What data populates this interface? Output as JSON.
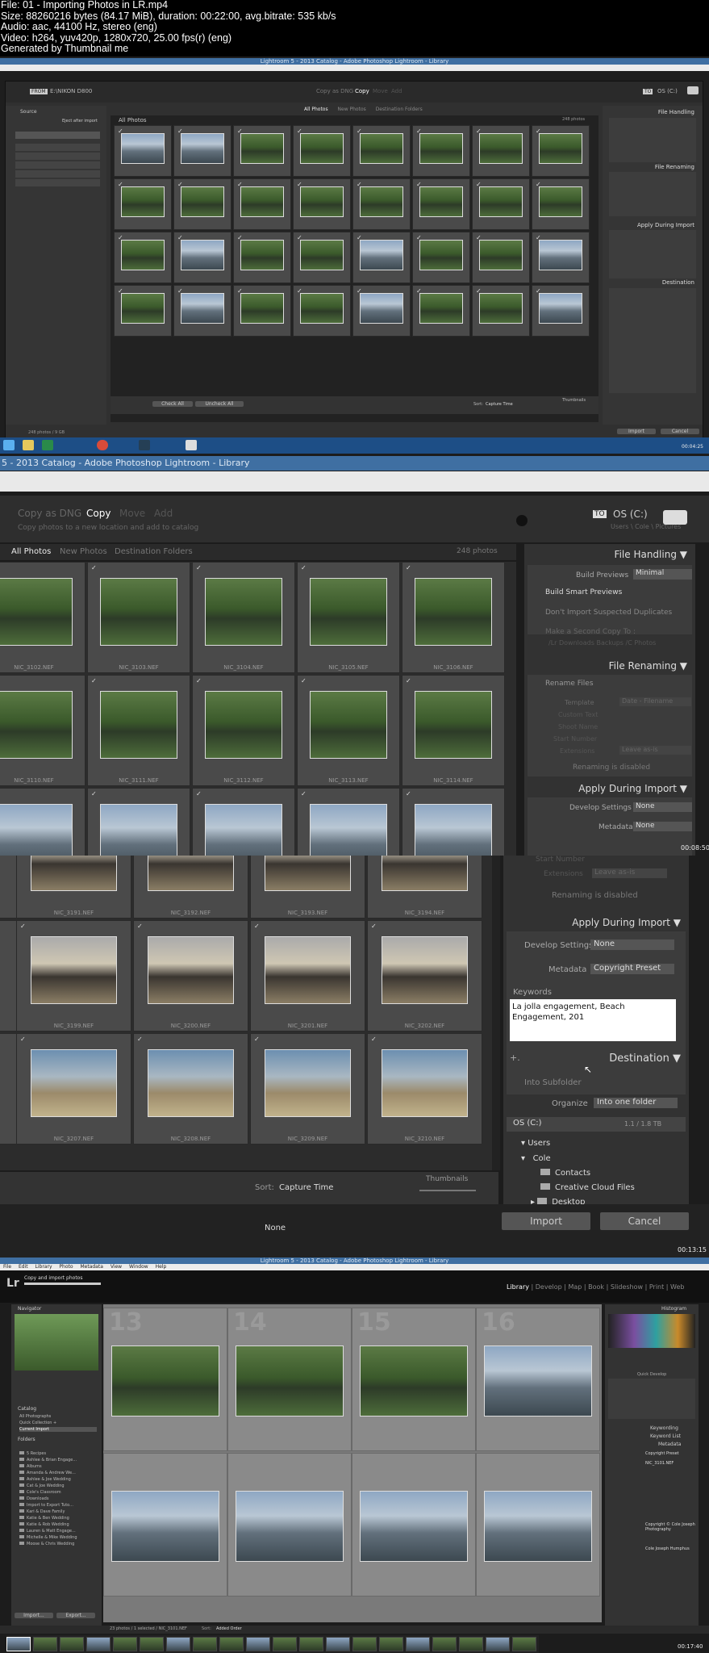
{
  "file_info": {
    "line1": "File: 01 - Importing Photos in LR.mp4",
    "line2": "Size: 88260216 bytes (84.17 MiB), duration: 00:22:00, avg.bitrate: 535 kb/s",
    "line3": "Audio: aac, 44100 Hz, stereo (eng)",
    "line4": "Video: h264, yuv420p, 1280x720, 25.00 fps(r) (eng)",
    "line5": "Generated by Thumbnail me"
  },
  "frame1": {
    "title": "Lightroom 5 - 2013 Catalog - Adobe Photoshop Lightroom - Library",
    "source_label": "FROM",
    "source_device": "E:\\NIKON D800",
    "modes": [
      "Copy as DNG",
      "Copy",
      "Move",
      "Add"
    ],
    "dest_label": "TO",
    "dest_drive": "OS (C:)",
    "tabs": [
      "All Photos",
      "New Photos",
      "Destination Folders"
    ],
    "grid_title": "All Photos",
    "count": "248 photos",
    "sources_title": "Source",
    "eject_label": "Eject after import",
    "buttons": {
      "check_all": "Check All",
      "uncheck_all": "Uncheck All",
      "import": "Import",
      "cancel": "Cancel"
    },
    "sort_label": "Sort:",
    "sort_value": "Capture Time",
    "thumbnails_label": "Thumbnails",
    "status": "248 photos / 9 GB",
    "right_sections": [
      "File Handling",
      "File Renaming",
      "Apply During Import",
      "Destination"
    ],
    "timestamp": "00:04:25"
  },
  "frame2": {
    "title": "5 - 2013 Catalog - Adobe Photoshop Lightroom - Library",
    "modes": [
      "Copy as DNG",
      "Copy",
      "Move",
      "Add"
    ],
    "subtitle": "Copy photos to a new location and add to catalog",
    "dest_label": "TO",
    "dest_drive": "OS (C:)",
    "dest_path": "Users \\ Cole \\ Pictures",
    "tabs": [
      "All Photos",
      "New Photos",
      "Destination Folders"
    ],
    "count": "248 photos",
    "row1": [
      "NIC_3102.NEF",
      "NIC_3103.NEF",
      "NIC_3104.NEF",
      "NIC_3105.NEF",
      "NIC_3106.NEF"
    ],
    "row2": [
      "NIC_3110.NEF",
      "NIC_3111.NEF",
      "NIC_3112.NEF",
      "NIC_3113.NEF",
      "NIC_3114.NEF"
    ],
    "file_handling": {
      "title": "File Handling",
      "build_previews_label": "Build Previews",
      "build_previews_value": "Minimal",
      "smart_previews": "Build Smart Previews",
      "no_duplicates": "Don't Import Suspected Duplicates",
      "second_copy": "Make a Second Copy To :",
      "second_copy_path": "/Lr Downloads Backups  /C Photos"
    },
    "file_renaming": {
      "title": "File Renaming",
      "rename_files": "Rename Files",
      "template_label": "Template",
      "template_value": "Date - Filename",
      "custom_text": "Custom Text",
      "shoot_name": "Shoot Name",
      "start_number": "Start Number",
      "extensions_label": "Extensions",
      "extensions_value": "Leave as-is",
      "disabled": "Renaming is disabled"
    },
    "apply": {
      "title": "Apply During Import",
      "develop_label": "Develop Settings",
      "develop_value": "None",
      "metadata_label": "Metadata",
      "metadata_value": "None"
    },
    "timestamp": "00:08:50"
  },
  "frame3": {
    "row1": [
      "NIC_3191.NEF",
      "NIC_3192.NEF",
      "NIC_3193.NEF",
      "NIC_3194.NEF"
    ],
    "row2": [
      "NIC_3199.NEF",
      "NIC_3200.NEF",
      "NIC_3201.NEF",
      "NIC_3202.NEF"
    ],
    "row3": [
      "NIC_3207.NEF",
      "NIC_3208.NEF",
      "NIC_3209.NEF",
      "NIC_3210.NEF"
    ],
    "start_number": "Start Number",
    "extensions_label": "Extensions",
    "extensions_value": "Leave as-is",
    "disabled": "Renaming is disabled",
    "apply_title": "Apply During Import",
    "develop_label": "Develop Settings",
    "develop_value": "None",
    "metadata_label": "Metadata",
    "metadata_value": "Copyright Preset",
    "keywords_label": "Keywords",
    "keywords_value": "La jolla engagement, Beach Engagement, 201",
    "destination_title": "Destination",
    "plus": "+.",
    "into_subfolder": "Into Subfolder",
    "organize_label": "Organize",
    "organize_value": "Into one folder",
    "drive": "OS (C:)",
    "drive_space": "1.1 / 1.8 TB",
    "tree": [
      "Users",
      "Cole",
      "Contacts",
      "Creative Cloud Files",
      "Desktop"
    ],
    "sort_label": "Sort:",
    "sort_value": "Capture Time",
    "thumbnails_label": "Thumbnails",
    "none_label": "None",
    "import": "Import",
    "cancel": "Cancel",
    "timestamp": "00:13:15"
  },
  "frame4": {
    "title": "Lightroom 5 - 2013 Catalog - Adobe Photoshop Lightroom - Library",
    "menu": [
      "File",
      "Edit",
      "Library",
      "Photo",
      "Metadata",
      "View",
      "Window",
      "Help"
    ],
    "logo": "Lr",
    "activity": "Copy and import photos",
    "modules": [
      "Library",
      "Develop",
      "Map",
      "Book",
      "Slideshow",
      "Print",
      "Web"
    ],
    "navigator": "Navigator",
    "catalog": "Catalog",
    "catalog_items": [
      "All Photographs",
      "Quick Collection +",
      "Current Import"
    ],
    "folders": "Folders",
    "folder_items": [
      "5 Recipes",
      "Ashlee & Brian Engage...",
      "Albums",
      "Amanda & Andrew We...",
      "Ashlee & Joe Wedding",
      "Cat & Joe Wedding",
      "Cole's Classroom",
      "Downloads",
      "Import to Export Tuto...",
      "Kari & Dave Family",
      "Katie & Ben Wedding",
      "Katie & Rob Wedding",
      "Lauren & Matt Engage...",
      "Michelle & Mike Wedding",
      "Moose & Chris Wedding"
    ],
    "grid_numbers": [
      "13",
      "14",
      "15",
      "16"
    ],
    "histogram": "Histogram",
    "quick_develop": "Quick Develop",
    "keywording": "Keywording",
    "keyword_list": "Keyword List",
    "metadata": "Metadata",
    "preset_value": "Copyright Preset",
    "file_name": "NIC_3101.NEF",
    "copyright": "Copyright © Cole Joseph Photography",
    "creator": "Cole Joseph Humphus",
    "filmstrip_info": "23 photos / 1 selected / NIC_3101.NEF",
    "sort_label": "Sort:",
    "sort_value": "Added Order",
    "import_btn": "Import...",
    "export_btn": "Export...",
    "timestamp": "00:17:40"
  }
}
